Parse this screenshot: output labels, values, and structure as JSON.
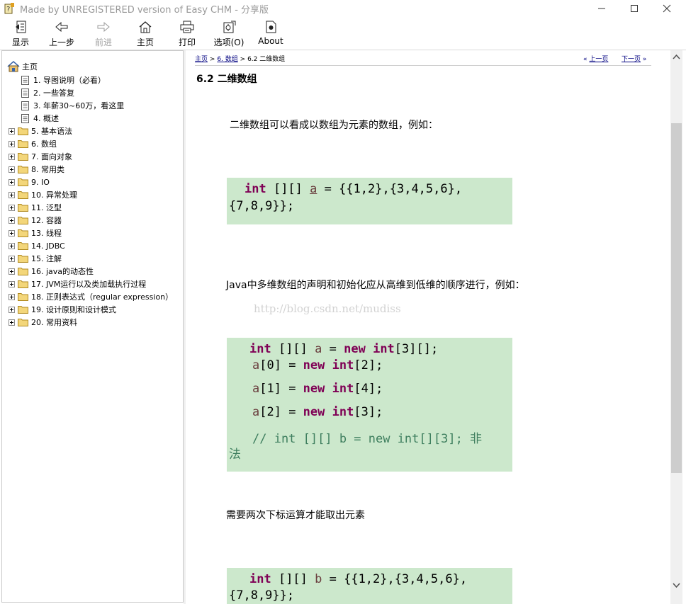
{
  "window": {
    "title": "Made by UNREGISTERED version of Easy CHM - 分享版"
  },
  "toolbar": {
    "buttons": [
      {
        "label": "显示",
        "icon": "show-panel-icon"
      },
      {
        "label": "上一步",
        "icon": "back-arrow-icon"
      },
      {
        "label": "前进",
        "icon": "forward-arrow-icon"
      },
      {
        "label": "主页",
        "icon": "home-icon"
      },
      {
        "label": "打印",
        "icon": "printer-icon"
      },
      {
        "label": "选项(O)",
        "icon": "options-icon"
      },
      {
        "label": "About",
        "icon": "about-icon"
      }
    ]
  },
  "nav": {
    "root": "主页",
    "items": [
      {
        "label": "1. 导图说明（必看）",
        "type": "page"
      },
      {
        "label": "2. 一些答复",
        "type": "page"
      },
      {
        "label": "3. 年薪30~60万，看这里",
        "type": "page"
      },
      {
        "label": "4. 概述",
        "type": "page"
      },
      {
        "label": "5. 基本语法",
        "type": "folder"
      },
      {
        "label": "6. 数组",
        "type": "folder"
      },
      {
        "label": "7. 面向对象",
        "type": "folder"
      },
      {
        "label": "8. 常用类",
        "type": "folder"
      },
      {
        "label": "9. IO",
        "type": "folder"
      },
      {
        "label": "10. 异常处理",
        "type": "folder"
      },
      {
        "label": "11. 泛型",
        "type": "folder"
      },
      {
        "label": "12. 容器",
        "type": "folder"
      },
      {
        "label": "13. 线程",
        "type": "folder"
      },
      {
        "label": "14. JDBC",
        "type": "folder"
      },
      {
        "label": "15. 注解",
        "type": "folder"
      },
      {
        "label": "16. java的动态性",
        "type": "folder"
      },
      {
        "label": "17. JVM运行以及类加载执行过程",
        "type": "folder"
      },
      {
        "label": "18. 正则表达式（regular expression）",
        "type": "folder"
      },
      {
        "label": "19. 设计原则和设计模式",
        "type": "folder"
      },
      {
        "label": "20. 常用资料",
        "type": "folder"
      }
    ]
  },
  "content": {
    "breadcrumb": {
      "home": "主页",
      "sep": ">",
      "section": "6. 数组",
      "current": "6.2 二维数组"
    },
    "pager": {
      "prev_arrow": "«",
      "prev": "上一页",
      "next": "下一页",
      "next_arrow": "»"
    },
    "heading": "6.2 二维数组",
    "para1": "二维数组可以看成以数组为元素的数组，例如：",
    "code1": {
      "l1_kw": "int",
      "l1_a": " [][] ",
      "l1_var": "a",
      "l1_b": " = {{1,2},{3,4,5,6},",
      "l2": "{7,8,9}};"
    },
    "para2": "Java中多维数组的声明和初始化应从高维到低维的顺序进行，例如：",
    "watermark": "http://blog.csdn.net/mudiss",
    "code2": {
      "r1_kw": "int",
      "r1_a": " [][] ",
      "r1_var": "a",
      "r1_b": " = ",
      "r1_kw2": "new",
      "r1_c": " ",
      "r1_kw3": "int",
      "r1_d": "[3][];",
      "r2_var": "a",
      "r2_a": "[0] = ",
      "r2_kw": "new",
      "r2_b": " ",
      "r2_kw2": "int",
      "r2_c": "[2];",
      "r3_var": "a",
      "r3_a": "[1] = ",
      "r3_kw": "new",
      "r3_b": " ",
      "r3_kw2": "int",
      "r3_c": "[4];",
      "r4_var": "a",
      "r4_a": "[2] = ",
      "r4_kw": "new",
      "r4_b": " ",
      "r4_kw2": "int",
      "r4_c": "[3];",
      "r5": "// int [][] b = new int[][3]; 非",
      "r6": "法"
    },
    "para3": "需要两次下标运算才能取出元素",
    "code3": {
      "l1_kw": "int",
      "l1_a": " [][] ",
      "l1_var": "b",
      "l1_b": " = {{1,2},{3,4,5,6},",
      "l2": "{7,8,9}};"
    }
  },
  "colors": {
    "code_bg": "#cce8cc",
    "keyword": "#7f0055",
    "variable": "#6a3e3e",
    "comment": "#3f7f5f",
    "link": "#000080"
  }
}
